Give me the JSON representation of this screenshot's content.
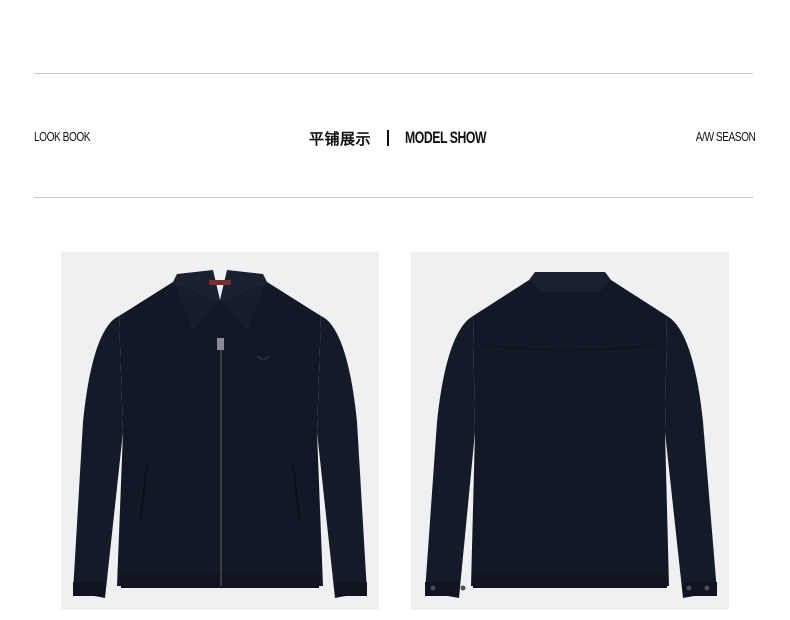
{
  "header": {
    "left_label": "LOOK BOOK",
    "title_cn": "平铺展示",
    "title_en": "MODEL SHOW",
    "right_label": "A/W SEASON"
  },
  "images": [
    {
      "view": "front",
      "subject": "navy zip-up jacket"
    },
    {
      "view": "back",
      "subject": "navy zip-up jacket"
    }
  ],
  "colors": {
    "jacket": "#131826",
    "background": "#eff0f2",
    "rule": "#c9c9c9"
  }
}
